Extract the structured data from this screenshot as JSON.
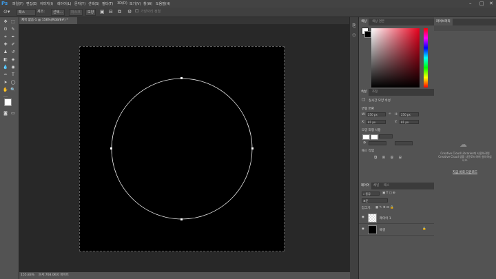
{
  "app": {
    "logo": "Ps"
  },
  "menu": [
    "파일(F)",
    "편집(E)",
    "이미지(I)",
    "레이어(L)",
    "문자(Y)",
    "선택(S)",
    "필터(T)",
    "3D(D)",
    "보기(V)",
    "창(W)",
    "도움말(H)"
  ],
  "window_controls": {
    "minimize": "–",
    "restore": "□",
    "close": "✕"
  },
  "options": {
    "tool_preset": "패스",
    "make_label": "제조:",
    "select_btn": "선택...",
    "mask_btn": "마스크",
    "shape_btn": "모양",
    "align_edges": "가장자리 정렬"
  },
  "document": {
    "tab_title": "제목 없음-1 @ 156%(RGB/8#) *",
    "zoom": "155.83%",
    "doc_info": "문서:768.0K/0 바이트"
  },
  "color_panel": {
    "tabs": [
      "색상",
      "색상 견본"
    ]
  },
  "properties_panel": {
    "tabs": [
      "속성",
      "조정"
    ],
    "title": "실시간 모양 속성",
    "transform_label": "변형 변환",
    "w_label": "W:",
    "w_value": "250 px",
    "h_label": "H:",
    "h_value": "250 px",
    "x_label": "X:",
    "x_value": "81 px",
    "y_label": "Y:",
    "y_value": "81 px",
    "appearance_label": "모양 외형 사항",
    "path_ops_label": "패스 작업"
  },
  "libraries_panel": {
    "tab": "라이브러리",
    "message": "Creative Cloud Libraries에 사용하려면 Creative Cloud 앱을 다운로드하여 설치하십시오.",
    "download_link": "지금 바로 다운로드"
  },
  "layers_panel": {
    "tabs": [
      "레이어",
      "채널",
      "패스"
    ],
    "kind_filter": "종류",
    "blend_mode": "표준",
    "lock_label": "잠그기:",
    "layers": [
      {
        "name": "레이어 1",
        "visible": true
      },
      {
        "name": "배경",
        "visible": true,
        "locked": true
      }
    ]
  },
  "colors": {
    "canvas": "#000000",
    "circle_stroke": "#e6e6e6",
    "ps_blue": "#3d9be9"
  }
}
